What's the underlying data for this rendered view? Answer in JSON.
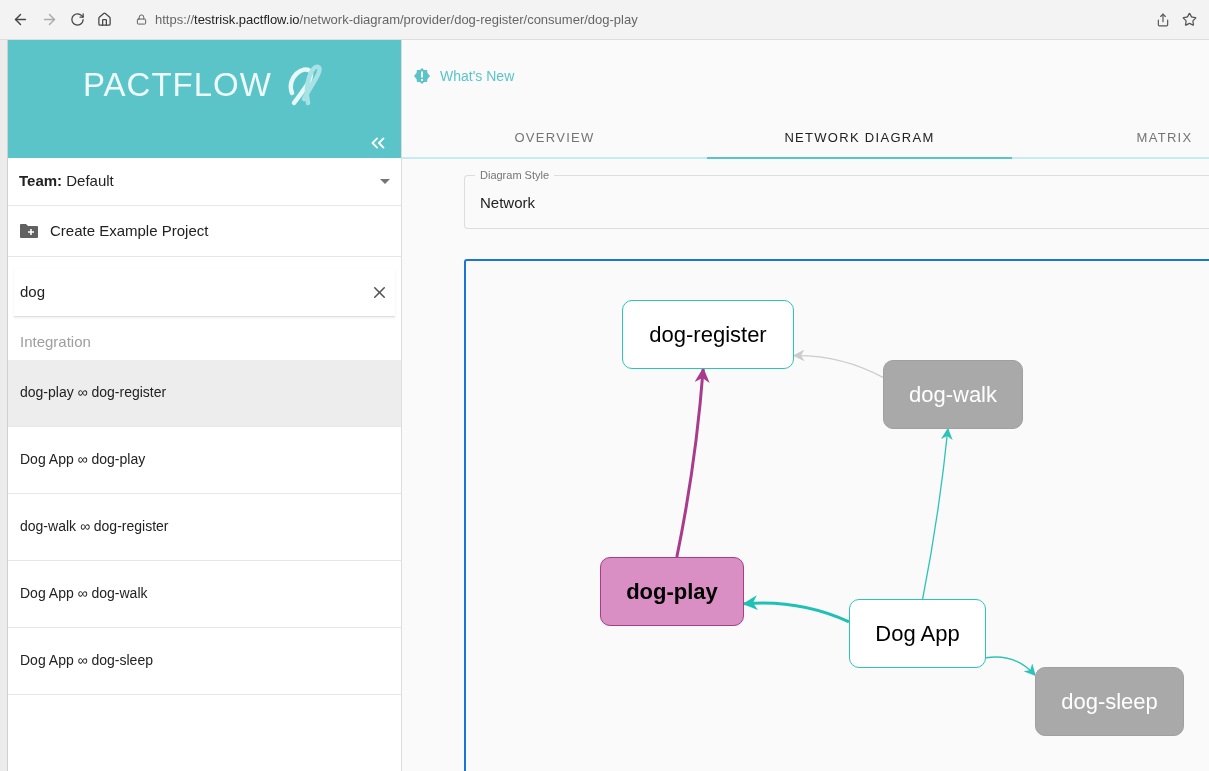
{
  "browser": {
    "url": "https://**testrisk.pactflow.io**/network-diagram/provider/dog-register/consumer/dog-play"
  },
  "sidebar": {
    "logo": "PACTFLOW",
    "team": {
      "label": "Team:",
      "value": "Default"
    },
    "create_button": "Create Example Project",
    "search": {
      "value": "dog"
    },
    "section_header": "Integration",
    "items": [
      {
        "label": "dog-play ∞ dog-register",
        "selected": true
      },
      {
        "label": "Dog App ∞ dog-play",
        "selected": false
      },
      {
        "label": "dog-walk ∞ dog-register",
        "selected": false
      },
      {
        "label": "Dog App ∞ dog-walk",
        "selected": false
      },
      {
        "label": "Dog App ∞ dog-sleep",
        "selected": false
      }
    ]
  },
  "main": {
    "whats_new": "What's New",
    "tabs": [
      {
        "label": "OVERVIEW",
        "selected": false
      },
      {
        "label": "NETWORK DIAGRAM",
        "selected": true
      },
      {
        "label": "MATRIX",
        "selected": false
      }
    ],
    "diagram_style": {
      "label": "Diagram Style",
      "value": "Network"
    },
    "diagram": {
      "nodes": [
        {
          "label": "dog-register",
          "kind": "normal"
        },
        {
          "label": "dog-walk",
          "kind": "faded"
        },
        {
          "label": "dog-play",
          "kind": "selected"
        },
        {
          "label": "Dog App",
          "kind": "normal"
        },
        {
          "label": "dog-sleep",
          "kind": "faded"
        }
      ],
      "edges": [
        {
          "kind": "highlighted"
        },
        {
          "kind": "faded"
        },
        {
          "kind": "normal"
        },
        {
          "kind": "related"
        },
        {
          "kind": "normal"
        }
      ]
    }
  }
}
